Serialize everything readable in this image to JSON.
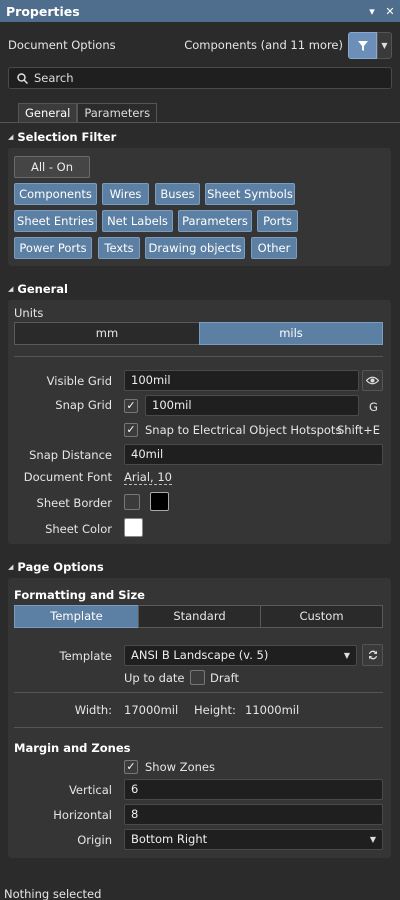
{
  "titlebar": {
    "title": "Properties",
    "pin_icon": "pin-icon",
    "close_icon": "close-icon"
  },
  "header": {
    "document_options": "Document Options",
    "components_filter": "Components (and 11 more)"
  },
  "search": {
    "placeholder": "Search"
  },
  "tabs": [
    {
      "label": "General"
    },
    {
      "label": "Parameters"
    }
  ],
  "selection_filter": {
    "heading": "Selection Filter",
    "all_on": "All - On",
    "chips": [
      "Components",
      "Wires",
      "Buses",
      "Sheet Symbols",
      "Sheet Entries",
      "Net Labels",
      "Parameters",
      "Ports",
      "Power Ports",
      "Texts",
      "Drawing objects",
      "Other"
    ]
  },
  "general": {
    "heading": "General",
    "units_label": "Units",
    "units": {
      "mm": "mm",
      "mils": "mils",
      "selected": "mils"
    },
    "visible_grid_label": "Visible Grid",
    "visible_grid_value": "100mil",
    "snap_grid_label": "Snap Grid",
    "snap_grid_value": "100mil",
    "snap_grid_shortcut": "G",
    "snap_hotspots_label": "Snap to Electrical Object Hotspots",
    "snap_hotspots_shortcut": "Shift+E",
    "snap_distance_label": "Snap Distance",
    "snap_distance_value": "40mil",
    "document_font_label": "Document Font",
    "document_font_value": "Arial, 10",
    "sheet_border_label": "Sheet Border",
    "sheet_color_label": "Sheet Color",
    "sheet_border_color": "#000000",
    "sheet_color": "#ffffff"
  },
  "page_options": {
    "heading": "Page Options",
    "formatting_heading": "Formatting and Size",
    "modes": [
      "Template",
      "Standard",
      "Custom"
    ],
    "selected_mode": "Template",
    "template_label": "Template",
    "template_value": "ANSI B Landscape (v. 5)",
    "up_to_date": "Up to date",
    "draft_label": "Draft",
    "width_label": "Width:",
    "width_value": "17000mil",
    "height_label": "Height:",
    "height_value": "11000mil",
    "margin_heading": "Margin and Zones",
    "show_zones_label": "Show Zones",
    "vertical_label": "Vertical",
    "vertical_value": "6",
    "horizontal_label": "Horizontal",
    "horizontal_value": "8",
    "origin_label": "Origin",
    "origin_value": "Bottom Right"
  },
  "status": {
    "text": "Nothing selected"
  },
  "colors": {
    "accent": "#5c7fa4",
    "titlebar": "#4f6d8c",
    "background": "#2b2b2b"
  }
}
